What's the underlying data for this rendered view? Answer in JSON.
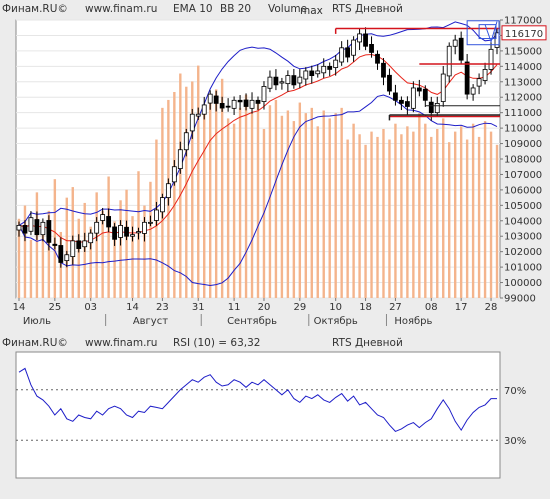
{
  "chart_data": [
    {
      "type": "candlestick",
      "header": {
        "source": "Финам.RU©",
        "site": "www.finam.ru",
        "ema": "EMA 10",
        "bb": "BB 20",
        "volume": "Volume",
        "max": "max",
        "instrument": "RTS Дневной"
      },
      "colors": {
        "ema": "#e8261c",
        "bb": "#1e1ec8",
        "volume": "#f4b48c",
        "candle": "#000000",
        "level_red": "#d4141c",
        "level_black": "#222222",
        "highlight_box": "#3355dd"
      },
      "last_price_label": "116170",
      "ylim": [
        99000,
        117000
      ],
      "yticks": [
        "117000",
        "116000",
        "115000",
        "114000",
        "113000",
        "112000",
        "111000",
        "110000",
        "109000",
        "108000",
        "107000",
        "106000",
        "105000",
        "104000",
        "103000",
        "102000",
        "101000",
        "100000",
        "99000"
      ],
      "xticks": [
        "14",
        "25",
        "03",
        "14",
        "23",
        "31",
        "11",
        "20",
        "29",
        "10",
        "18",
        "27",
        "08",
        "17",
        "28"
      ],
      "months": [
        "Июль",
        "Август",
        "Сентябрь",
        "Октябрь",
        "Ноябрь"
      ],
      "levels": {
        "red_top": 116450,
        "red_mid": 114150,
        "red_low": 110750,
        "black_low": 110850
      },
      "closes": [
        103700,
        103200,
        104200,
        103100,
        103900,
        102600,
        102400,
        101300,
        101800,
        102700,
        102200,
        102700,
        103200,
        103900,
        104400,
        103600,
        102800,
        103700,
        103000,
        103100,
        103300,
        103900,
        103900,
        104700,
        105500,
        106400,
        107500,
        108600,
        109700,
        110900,
        110900,
        111500,
        112200,
        111600,
        111300,
        111400,
        111800,
        111700,
        111400,
        111800,
        111600,
        112700,
        113300,
        112800,
        113000,
        113400,
        112800,
        113300,
        113700,
        113400,
        113700,
        114000,
        113800,
        114400,
        115200,
        114600,
        115700,
        116100,
        115300,
        114900,
        114200,
        113300,
        112400,
        111800,
        111600,
        111400,
        112600,
        112400,
        111800,
        111000,
        111600,
        113500,
        115300,
        115700,
        114400,
        112200,
        112600,
        113200,
        113800,
        115100,
        116170
      ],
      "volume_pct": [
        30,
        35,
        22,
        40,
        28,
        33,
        45,
        25,
        38,
        42,
        30,
        36,
        27,
        40,
        33,
        46,
        29,
        37,
        41,
        31,
        48,
        35,
        44,
        60,
        72,
        75,
        78,
        85,
        80,
        82,
        88,
        70,
        76,
        79,
        83,
        68,
        66,
        72,
        77,
        70,
        74,
        64,
        73,
        75,
        69,
        71,
        67,
        74,
        70,
        72,
        65,
        71,
        68,
        70,
        72,
        60,
        66,
        62,
        58,
        63,
        61,
        64,
        60,
        66,
        62,
        65,
        63,
        70,
        66,
        61,
        64,
        68,
        59,
        63,
        65,
        60,
        66,
        61,
        67,
        63,
        58
      ],
      "rsi": {
        "label": "RSI (10) = 63,32",
        "source": "Финам.RU©",
        "site": "www.finam.ru",
        "instrument": "RTS Дневной",
        "levels": [
          "70%",
          "30%"
        ],
        "values": [
          84,
          87,
          74,
          65,
          62,
          57,
          50,
          55,
          47,
          45,
          50,
          48,
          47,
          53,
          50,
          55,
          57,
          55,
          50,
          48,
          53,
          52,
          57,
          56,
          55,
          60,
          65,
          70,
          74,
          78,
          76,
          80,
          82,
          76,
          73,
          74,
          78,
          76,
          72,
          76,
          74,
          78,
          74,
          70,
          66,
          70,
          63,
          60,
          65,
          63,
          66,
          62,
          60,
          64,
          67,
          61,
          65,
          58,
          60,
          55,
          50,
          48,
          42,
          37,
          39,
          42,
          44,
          40,
          44,
          47,
          55,
          62,
          55,
          45,
          38,
          46,
          52,
          56,
          58,
          63,
          63
        ]
      }
    }
  ]
}
